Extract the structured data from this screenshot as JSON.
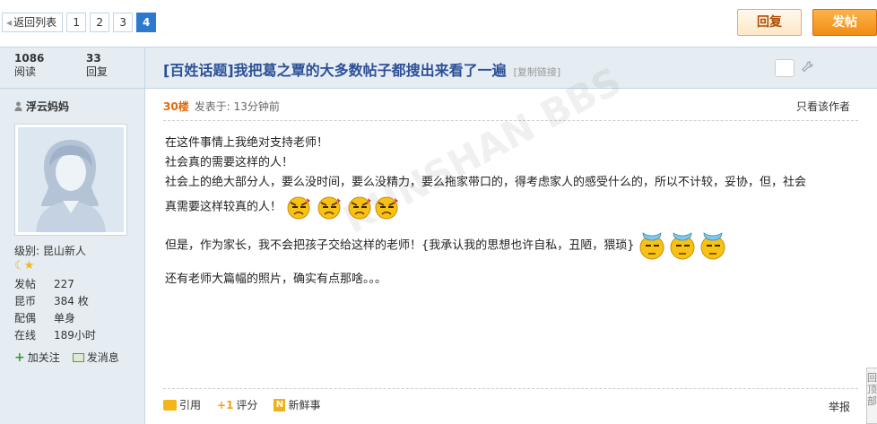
{
  "pager": {
    "back_label": "返回列表",
    "pages": [
      "1",
      "2",
      "3",
      "4"
    ],
    "current": "4"
  },
  "actions": {
    "reply_label": "回复",
    "post_label": "发帖"
  },
  "thread": {
    "views_count": "1086",
    "views_label": "阅读",
    "replies_count": "33",
    "replies_label": "回复",
    "title": "[百姓话题]我把葛之覃的大多数帖子都搜出来看了一遍",
    "copy_link": "[复制链接]"
  },
  "author": {
    "name": "浮云妈妈",
    "level_label": "级别:",
    "level": "昆山新人",
    "stats": [
      {
        "key": "发帖",
        "value": "227"
      },
      {
        "key": "昆币",
        "value": "384 枚"
      },
      {
        "key": "配偶",
        "value": "单身"
      },
      {
        "key": "在线",
        "value": "189小时"
      }
    ],
    "follow_label": "加关注",
    "message_label": "发消息"
  },
  "post": {
    "floor": "30楼",
    "posted_at": "发表于: 13分钟前",
    "only_author": "只看该作者",
    "lines": [
      "在这件事情上我绝对支持老师！",
      "社会真的需要这样的人！",
      "社会上的绝大部分人，要么没时间，要么没精力，要么拖家带口的，得考虑家人的感受什么的，所以不计较，妥协，但，社会",
      "真需要这样较真的人！",
      "但是，作为家长，我不会把孩子交给这样的老师！{我承认我的思想也许自私，丑陋，猥琐}",
      "还有老师大篇幅的照片，确实有点那啥。。。"
    ],
    "watermark": "KUNSHAN BBS",
    "quote_label": "引用",
    "rate_label": "评分",
    "fresh_label": "新鲜事",
    "report_label": "举报"
  },
  "totop": {
    "label": "回顶部"
  },
  "icons": {
    "user": "user-icon",
    "follow": "plus-icon",
    "message": "mail-icon",
    "quote": "quote-icon",
    "rate": "rate-icon",
    "fresh": "newsfeed-icon",
    "tools": "wrench-icon"
  },
  "colors": {
    "accent": "#2b7acd",
    "title": "#2c4f97",
    "floor": "#e06a0f",
    "header_bg": "#e5edf2",
    "post_button": "#f08d13"
  }
}
